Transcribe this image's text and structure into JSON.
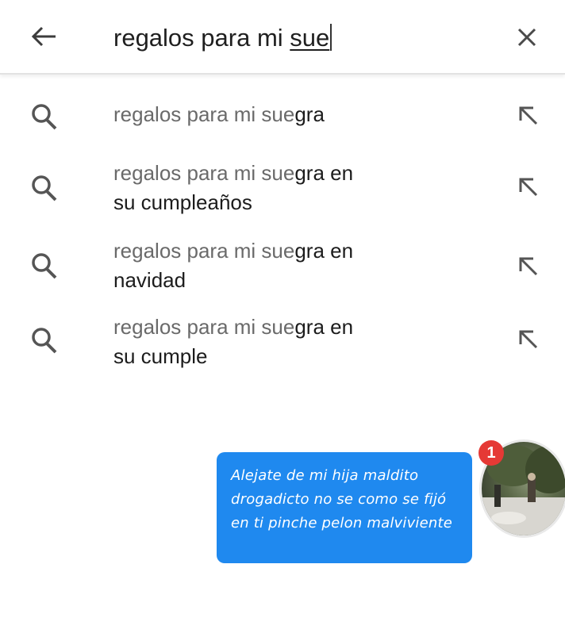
{
  "search": {
    "query_prefix": "regalos para mi ",
    "query_typed": "sue"
  },
  "suggestions": [
    {
      "prefix": "regalos para mi sue",
      "completion": "gra",
      "line2": ""
    },
    {
      "prefix": "regalos para mi sue",
      "completion": "gra en",
      "line2": "su cumpleaños"
    },
    {
      "prefix": "regalos para mi sue",
      "completion": "gra en",
      "line2": "navidad"
    },
    {
      "prefix": "regalos para mi sue",
      "completion": "gra en",
      "line2": "su cumple"
    }
  ],
  "chat": {
    "message": "Alejate de mi hija maldito drogadicto no se como se fijó en ti pinche pelon malviviente",
    "unread_count": "1",
    "bubble_color": "#1f89ef",
    "badge_color": "#e53935"
  },
  "icons": {
    "back": "arrow-left-icon",
    "clear": "close-icon",
    "suggestion": "search-icon",
    "fill": "arrow-up-left-icon"
  }
}
